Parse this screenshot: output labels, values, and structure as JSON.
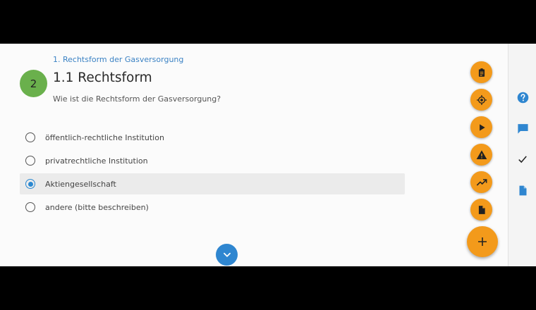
{
  "breadcrumb": "1. Rechtsform der Gasversorgung",
  "step_number": "2",
  "section_title": "1.1 Rechtsform",
  "question": "Wie ist die Rechtsform der Gasversorgung?",
  "options": [
    {
      "label": "öffentlich-rechtliche Institution",
      "selected": false
    },
    {
      "label": "privatrechtliche Institution",
      "selected": false
    },
    {
      "label": "Aktiengesellschaft",
      "selected": true
    },
    {
      "label": "andere (bitte beschreiben)",
      "selected": false
    }
  ],
  "action_buttons": [
    "clipboard-icon",
    "target-icon",
    "play-icon",
    "warning-icon",
    "trending-up-icon",
    "document-icon"
  ],
  "add_button": "plus-icon",
  "side_icons": [
    "help-icon",
    "comment-icon",
    "checkmark-icon",
    "file-icon"
  ],
  "colors": {
    "accent_orange": "#f39a1b",
    "accent_blue": "#2f86d0",
    "step_green": "#6ab04c"
  }
}
